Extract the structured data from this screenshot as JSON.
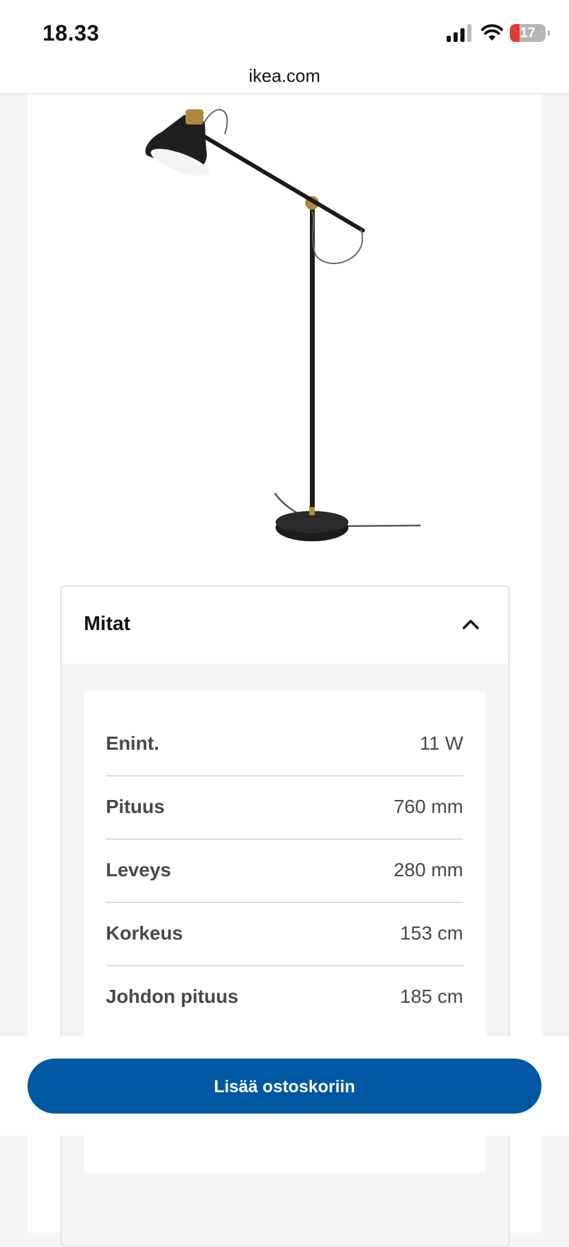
{
  "status_bar": {
    "time": "18.33",
    "battery": "17"
  },
  "browser": {
    "url": "ikea.com"
  },
  "dimensions_panel": {
    "title": "Mitat",
    "rows": [
      {
        "label": "Enint.",
        "value": "11 W"
      },
      {
        "label": "Pituus",
        "value": "760 mm"
      },
      {
        "label": "Leveys",
        "value": "280 mm"
      },
      {
        "label": "Korkeus",
        "value": "153 cm"
      },
      {
        "label": "Johdon pituus",
        "value": "185 cm"
      }
    ]
  },
  "cta": {
    "label": "Lisää ostoskoriin"
  },
  "colors": {
    "brand_blue": "#0058a3",
    "battery_low": "#e53935"
  },
  "icons": [
    "signal-icon",
    "wifi-icon",
    "battery-icon",
    "chevron-up-icon"
  ]
}
